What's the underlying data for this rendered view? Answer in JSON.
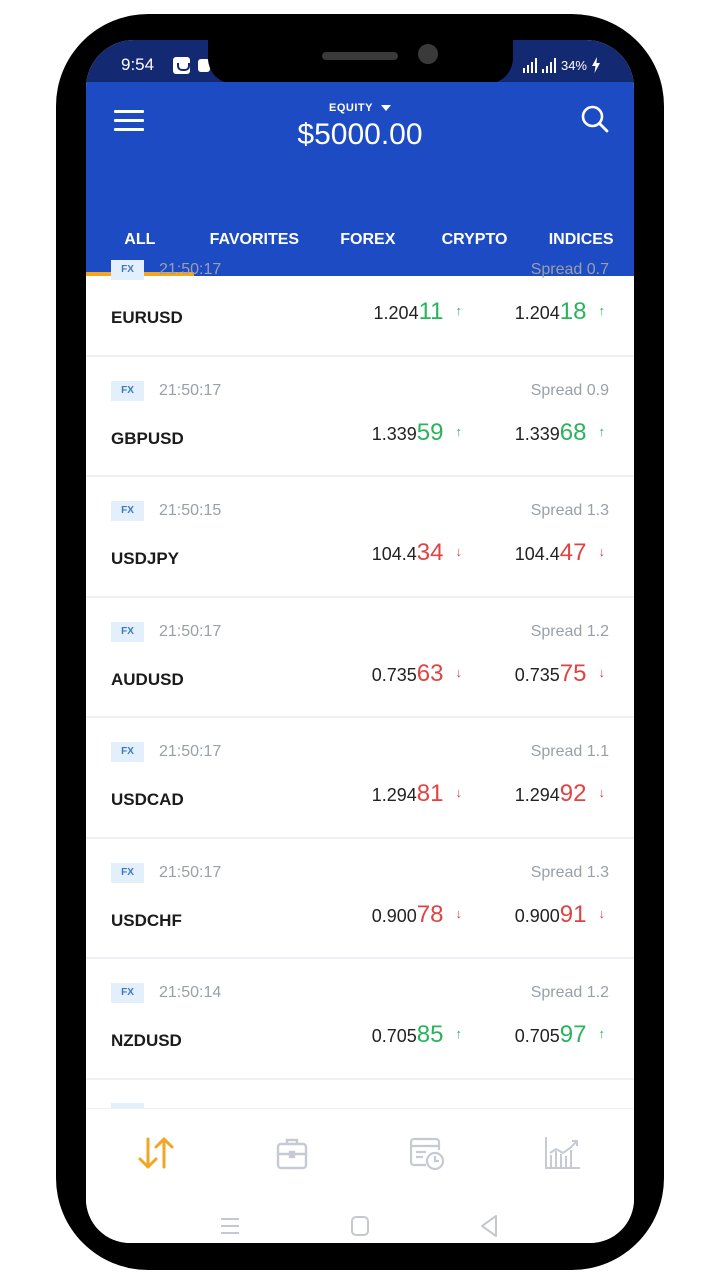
{
  "status_bar": {
    "time": "9:54",
    "battery": "34%"
  },
  "header": {
    "equity_label": "EQUITY",
    "equity_value": "$5000.00"
  },
  "tabs": [
    {
      "label": "ALL",
      "active": true
    },
    {
      "label": "FAVORITES",
      "active": false
    },
    {
      "label": "FOREX",
      "active": false
    },
    {
      "label": "CRYPTO",
      "active": false
    },
    {
      "label": "INDICES",
      "active": false
    }
  ],
  "instruments": [
    {
      "badge": "FX",
      "time": "21:50:17",
      "spread": "Spread 0.7",
      "symbol": "EURUSD",
      "bid": {
        "prefix": "1.204",
        "big": "11"
      },
      "ask": {
        "prefix": "1.204",
        "big": "18"
      },
      "direction": "up"
    },
    {
      "badge": "FX",
      "time": "21:50:17",
      "spread": "Spread 0.9",
      "symbol": "GBPUSD",
      "bid": {
        "prefix": "1.339",
        "big": "59"
      },
      "ask": {
        "prefix": "1.339",
        "big": "68"
      },
      "direction": "up"
    },
    {
      "badge": "FX",
      "time": "21:50:15",
      "spread": "Spread 1.3",
      "symbol": "USDJPY",
      "bid": {
        "prefix": "104.4",
        "big": "34"
      },
      "ask": {
        "prefix": "104.4",
        "big": "47"
      },
      "direction": "down"
    },
    {
      "badge": "FX",
      "time": "21:50:17",
      "spread": "Spread 1.2",
      "symbol": "AUDUSD",
      "bid": {
        "prefix": "0.735",
        "big": "63"
      },
      "ask": {
        "prefix": "0.735",
        "big": "75"
      },
      "direction": "down"
    },
    {
      "badge": "FX",
      "time": "21:50:17",
      "spread": "Spread 1.1",
      "symbol": "USDCAD",
      "bid": {
        "prefix": "1.294",
        "big": "81"
      },
      "ask": {
        "prefix": "1.294",
        "big": "92"
      },
      "direction": "down"
    },
    {
      "badge": "FX",
      "time": "21:50:17",
      "spread": "Spread 1.3",
      "symbol": "USDCHF",
      "bid": {
        "prefix": "0.900",
        "big": "78"
      },
      "ask": {
        "prefix": "0.900",
        "big": "91"
      },
      "direction": "down"
    },
    {
      "badge": "FX",
      "time": "21:50:14",
      "spread": "Spread 1.2",
      "symbol": "NZDUSD",
      "bid": {
        "prefix": "0.705",
        "big": "85"
      },
      "ask": {
        "prefix": "0.705",
        "big": "97"
      },
      "direction": "up"
    }
  ],
  "arrows": {
    "up": "↑",
    "down": "↓"
  },
  "bottom_nav": [
    {
      "icon": "trade-arrows-icon",
      "active": true
    },
    {
      "icon": "portfolio-briefcase-icon",
      "active": false
    },
    {
      "icon": "history-calendar-clock-icon",
      "active": false
    },
    {
      "icon": "analytics-chart-icon",
      "active": false
    }
  ],
  "colors": {
    "brand_blue": "#1d4bc4",
    "status_bar": "#132a73",
    "active_tab_indicator": "#f2a623",
    "price_up": "#27b45a",
    "price_down": "#e04343",
    "nav_active": "#f2a623",
    "nav_inactive": "#c5cad3"
  }
}
